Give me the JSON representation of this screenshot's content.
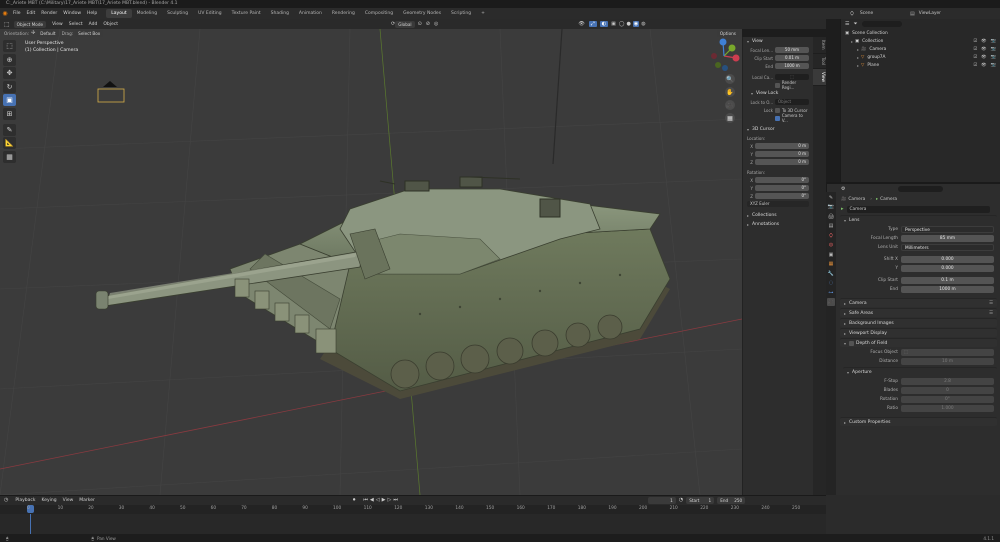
{
  "window": {
    "title": "C:_Ariete MBT (C:\\Military\\17_Ariete MBT\\17_Ariete MBT.blend) - Blender 4.1"
  },
  "menu": {
    "items": [
      "File",
      "Edit",
      "Render",
      "Window",
      "Help"
    ],
    "workspaces": [
      "Layout",
      "Modeling",
      "Sculpting",
      "UV Editing",
      "Texture Paint",
      "Shading",
      "Animation",
      "Rendering",
      "Compositing",
      "Geometry Nodes",
      "Scripting"
    ],
    "active_workspace": "Layout",
    "add_tab": "+"
  },
  "top_right": {
    "scene_label": "Scene",
    "viewlayer_label": "ViewLayer"
  },
  "viewport_header": {
    "mode": "Object Mode",
    "menus": [
      "View",
      "Select",
      "Add",
      "Object"
    ],
    "transform": "Global",
    "options": "Options"
  },
  "orientation_bar": {
    "orientation_label": "Orientation:",
    "orientation_value": "Default",
    "drag_label": "Drag:",
    "drag_value": "Select Box"
  },
  "viewport": {
    "line1": "User Perspective",
    "line2": "(1) Collection | Camera"
  },
  "npanel": {
    "tabs": [
      "Item",
      "Tool",
      "View"
    ],
    "active_tab": "View",
    "view": {
      "title": "View",
      "focal_label": "Focal Len...",
      "focal_value": "50 mm",
      "clip_start_label": "Clip Start",
      "clip_start_value": "0.01 m",
      "end_label": "End",
      "end_value": "1000 m",
      "local_camera_label": "Local Ca...",
      "render_region": "Render Regi..."
    },
    "view_lock": {
      "title": "View Lock",
      "lock_obj_label": "Lock to O...",
      "lock_obj_value": "Object",
      "lock_label": "Lock",
      "lock_cursor": "To 3D Cursor",
      "camera_to_view": "Camera to V..."
    },
    "cursor": {
      "title": "3D Cursor",
      "location_label": "Location:",
      "loc": [
        {
          "axis": "X",
          "value": "0 m"
        },
        {
          "axis": "Y",
          "value": "0 m"
        },
        {
          "axis": "Z",
          "value": "0 m"
        }
      ],
      "rotation_label": "Rotation:",
      "rot": [
        {
          "axis": "X",
          "value": "0°"
        },
        {
          "axis": "Y",
          "value": "0°"
        },
        {
          "axis": "Z",
          "value": "0°"
        }
      ],
      "rotation_mode": "XYZ Euler"
    },
    "collections": "Collections",
    "annotations": "Annotations"
  },
  "outliner": {
    "root": "Scene Collection",
    "items": [
      {
        "name": "Collection",
        "indent": 1
      },
      {
        "name": "Camera",
        "indent": 2
      },
      {
        "name": "group7A",
        "indent": 2
      },
      {
        "name": "Plane",
        "indent": 2
      }
    ]
  },
  "properties": {
    "breadcrumb_a": "Camera",
    "breadcrumb_b": "Camera",
    "datablock": "Camera",
    "lens": {
      "title": "Lens",
      "type_label": "Type",
      "type_value": "Perspective",
      "focal_label": "Focal Length",
      "focal_value": "85 mm",
      "lens_unit_label": "Lens Unit",
      "lens_unit_value": "Millimeters",
      "shift_x_label": "Shift X",
      "shift_x_value": "0.000",
      "shift_y_label": "Y",
      "shift_y_value": "0.000",
      "clip_start_label": "Clip Start",
      "clip_start_value": "0.1 m",
      "clip_end_label": "End",
      "clip_end_value": "1000 m"
    },
    "sections": [
      "Camera",
      "Safe Areas",
      "Background Images",
      "Viewport Display"
    ],
    "dof": {
      "title": "Depth of Field",
      "focus_object_label": "Focus Object",
      "distance_label": "Distance",
      "distance_value": "10 m",
      "aperture_title": "Aperture",
      "fstop_label": "F-Stop",
      "fstop_value": "2.8",
      "blades_label": "Blades",
      "blades_value": "0",
      "rotation_label": "Rotation",
      "rotation_value": "0°",
      "ratio_label": "Ratio",
      "ratio_value": "1.000"
    },
    "custom_props": "Custom Properties"
  },
  "timeline": {
    "menus": [
      "Playback",
      "Keying",
      "View",
      "Marker"
    ],
    "current_frame": "1",
    "start_label": "Start",
    "start_value": "1",
    "end_label": "End",
    "end_value": "250",
    "ticks": [
      "0",
      "10",
      "20",
      "30",
      "40",
      "50",
      "60",
      "70",
      "80",
      "90",
      "100",
      "110",
      "120",
      "130",
      "140",
      "150",
      "160",
      "170",
      "180",
      "190",
      "200",
      "210",
      "220",
      "230",
      "240",
      "250"
    ]
  },
  "status": {
    "left": "Pan View",
    "right": "4.1.1"
  },
  "colors": {
    "accent": "#4772b3",
    "x_axis": "#cc3d50",
    "y_axis": "#79a82b",
    "z_axis": "#3f80d6"
  }
}
